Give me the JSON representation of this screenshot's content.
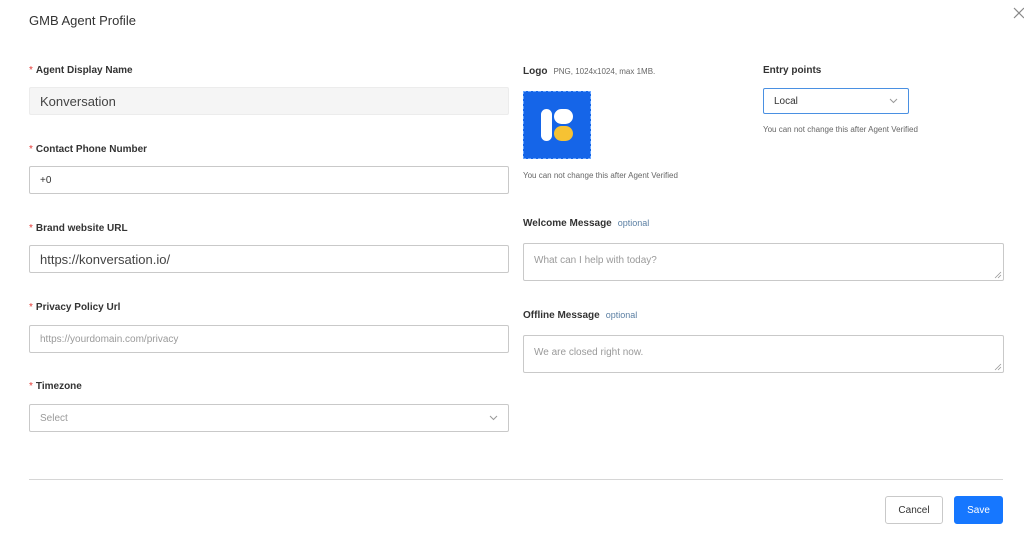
{
  "modal": {
    "title": "GMB Agent Profile"
  },
  "form": {
    "agent_display_name": {
      "label": "Agent Display Name",
      "value": "Konversation"
    },
    "contact_phone": {
      "label": "Contact Phone Number",
      "value": "+0"
    },
    "brand_website": {
      "label": "Brand website URL",
      "value": "https://konversation.io/"
    },
    "privacy_policy": {
      "label": "Privacy Policy Url",
      "placeholder": "https://yourdomain.com/privacy"
    },
    "timezone": {
      "label": "Timezone",
      "placeholder": "Select"
    },
    "logo": {
      "label": "Logo",
      "hint": "PNG, 1024x1024, max 1MB.",
      "note": "You can not change this after Agent Verified"
    },
    "entry_points": {
      "label": "Entry points",
      "value": "Local",
      "note": "You can not change this after Agent Verified"
    },
    "welcome_message": {
      "label": "Welcome Message",
      "optional": "optional",
      "placeholder": "What can I help with today?"
    },
    "offline_message": {
      "label": "Offline Message",
      "optional": "optional",
      "placeholder": "We are closed right now."
    }
  },
  "footer": {
    "cancel_label": "Cancel",
    "save_label": "Save"
  },
  "colors": {
    "primary": "#1677ff",
    "required": "#e53935",
    "logo_bg": "#1565e8",
    "logo_accent": "#f6c233"
  }
}
